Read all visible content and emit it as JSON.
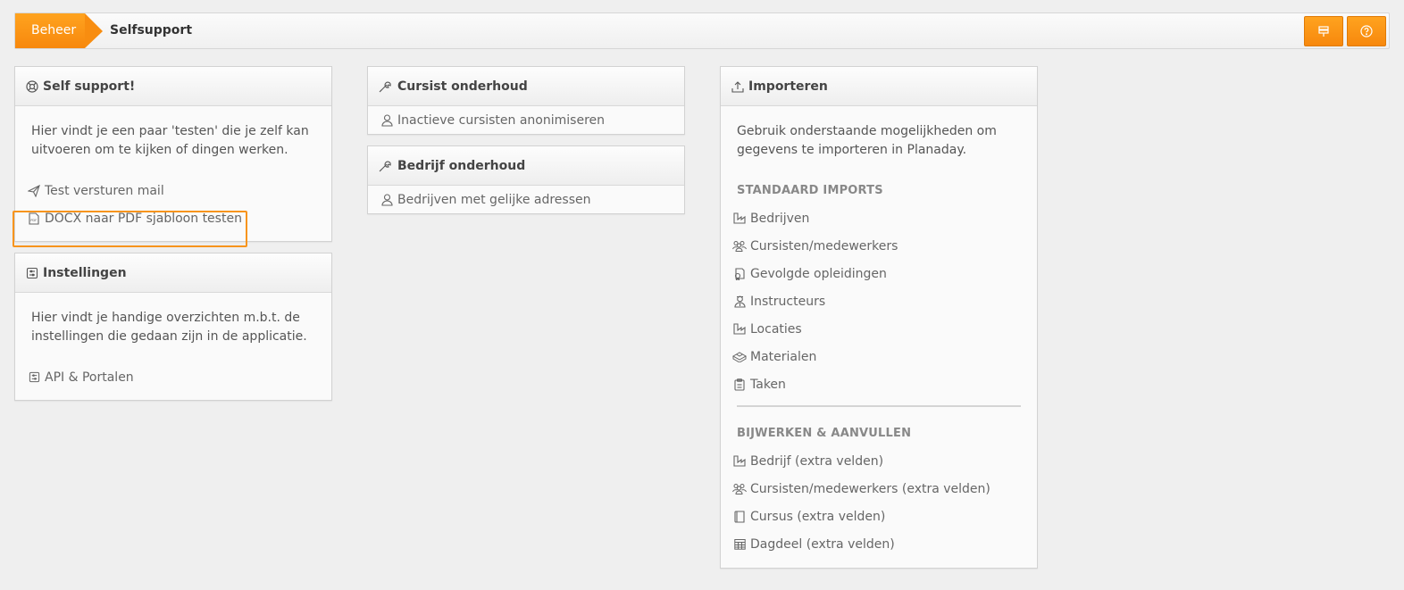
{
  "breadcrumb": {
    "home": "Beheer",
    "current": "Selfsupport"
  },
  "topbar": {
    "pin_icon": "pin-icon",
    "help_icon": "help-icon"
  },
  "accent_color": "#f7880d",
  "self_support": {
    "title": "Self support!",
    "description": "Hier vindt je een paar 'testen' die je zelf kan uitvoeren om te kijken of dingen werken.",
    "links": [
      {
        "label": "Test versturen mail",
        "icon": "send-icon"
      },
      {
        "label": "DOCX naar PDF sjabloon testen",
        "icon": "pdf-icon"
      }
    ]
  },
  "instellingen": {
    "title": "Instellingen",
    "description": "Hier vindt je handige overzichten m.b.t. de instellingen die gedaan zijn in de applicatie.",
    "links": [
      {
        "label": "API & Portalen",
        "icon": "settings-icon"
      }
    ]
  },
  "cursist_onderhoud": {
    "title": "Cursist onderhoud",
    "links": [
      {
        "label": "Inactieve cursisten anonimiseren",
        "icon": "user-icon"
      }
    ]
  },
  "bedrijf_onderhoud": {
    "title": "Bedrijf onderhoud",
    "links": [
      {
        "label": "Bedrijven met gelijke adressen",
        "icon": "user-icon"
      }
    ]
  },
  "importeren": {
    "title": "Importeren",
    "description": "Gebruik onderstaande mogelijkheden om gegevens te importeren in Planaday.",
    "standard_header": "STANDAARD IMPORTS",
    "standard": [
      {
        "label": "Bedrijven",
        "icon": "factory-icon"
      },
      {
        "label": "Cursisten/medewerkers",
        "icon": "users-icon"
      },
      {
        "label": "Gevolgde opleidingen",
        "icon": "certificate-icon"
      },
      {
        "label": "Instructeurs",
        "icon": "instructor-icon"
      },
      {
        "label": "Locaties",
        "icon": "factory-icon"
      },
      {
        "label": "Materialen",
        "icon": "boxes-icon"
      },
      {
        "label": "Taken",
        "icon": "clipboard-icon"
      }
    ],
    "extra_header": "BIJWERKEN & AANVULLEN",
    "extra": [
      {
        "label": "Bedrijf (extra velden)",
        "icon": "factory-icon"
      },
      {
        "label": "Cursisten/medewerkers (extra velden)",
        "icon": "users-icon"
      },
      {
        "label": "Cursus (extra velden)",
        "icon": "book-icon"
      },
      {
        "label": "Dagdeel (extra velden)",
        "icon": "calendar-icon"
      }
    ]
  }
}
